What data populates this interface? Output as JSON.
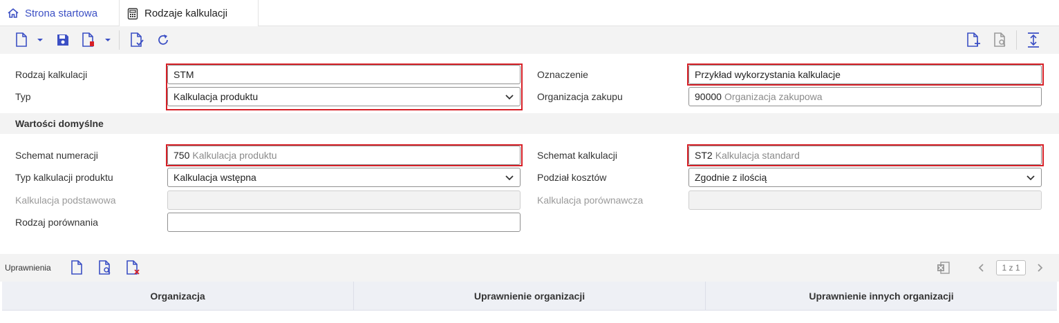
{
  "tabs": {
    "home_label": "Strona startowa",
    "active_label": "Rodzaje kalkulacji"
  },
  "toolbar": {
    "icons": [
      "new-document-icon",
      "save-icon",
      "delete-document-icon",
      "validate-icon",
      "refresh-icon",
      "add-document-icon",
      "preview-document-icon",
      "expand-vertical-icon"
    ]
  },
  "form": {
    "rodzaj_kalkulacji": {
      "label": "Rodzaj kalkulacji",
      "value": "STM"
    },
    "typ": {
      "label": "Typ",
      "value": "Kalkulacja produktu"
    },
    "oznaczenie": {
      "label": "Oznaczenie",
      "value": "Przykład wykorzystania kalkulacje"
    },
    "organizacja_zakupu": {
      "label": "Organizacja zakupu",
      "code": "90000",
      "desc": "Organizacja zakupowa"
    }
  },
  "defaults": {
    "section_title": "Wartości domyślne",
    "schemat_numeracji": {
      "label": "Schemat numeracji",
      "code": "750",
      "desc": "Kalkulacja produktu"
    },
    "typ_kalkulacji_produktu": {
      "label": "Typ kalkulacji produktu",
      "value": "Kalkulacja wstępna"
    },
    "kalkulacja_podstawowa": {
      "label": "Kalkulacja podstawowa",
      "value": ""
    },
    "rodzaj_porownania": {
      "label": "Rodzaj porównania",
      "value": ""
    },
    "schemat_kalkulacji": {
      "label": "Schemat kalkulacji",
      "code": "ST2",
      "desc": "Kalkulacja standard"
    },
    "podzial_kosztow": {
      "label": "Podział kosztów",
      "value": "Zgodnie z ilością"
    },
    "kalkulacja_porownawcza": {
      "label": "Kalkulacja porównawcza",
      "value": ""
    }
  },
  "permissions": {
    "title": "Uprawnienia",
    "pager": "1 z 1",
    "columns": [
      "Organizacja",
      "Uprawnienie organizacji",
      "Uprawnienie innych organizacji"
    ]
  },
  "colors": {
    "accent": "#3b4fc4",
    "highlight": "#d61f26"
  }
}
